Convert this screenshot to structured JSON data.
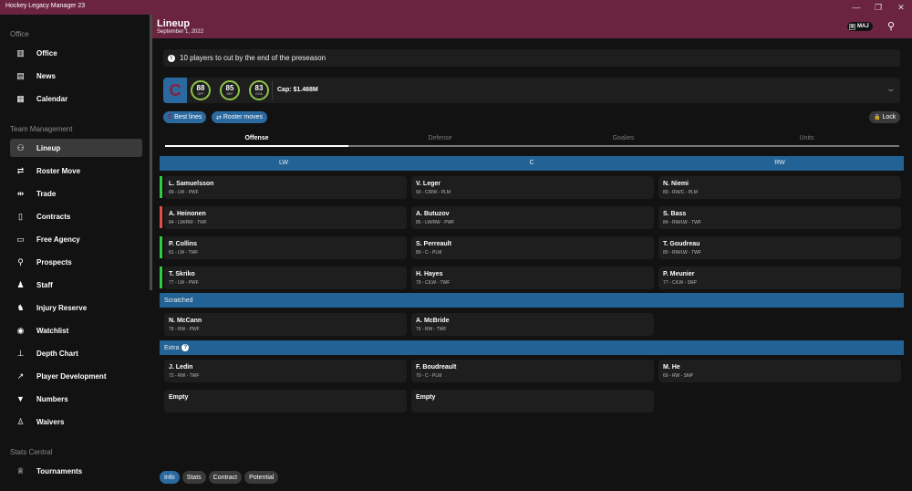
{
  "window": {
    "title": "Hockey Legacy Manager 23",
    "controls": [
      "—",
      "❐",
      "✕"
    ]
  },
  "sidebar": {
    "sections": [
      {
        "label": "Office",
        "items": [
          {
            "label": "Office",
            "icon": "building-icon",
            "glyph": "▥"
          },
          {
            "label": "News",
            "icon": "newspaper-icon",
            "glyph": "▤"
          },
          {
            "label": "Calendar",
            "icon": "calendar-icon",
            "glyph": "▦"
          }
        ]
      },
      {
        "label": "Team Management",
        "items": [
          {
            "label": "Lineup",
            "icon": "users-icon",
            "glyph": "👥",
            "active": true
          },
          {
            "label": "Roster Move",
            "icon": "exchange-icon",
            "glyph": "⇄"
          },
          {
            "label": "Trade",
            "icon": "trade-icon",
            "glyph": "⇹"
          },
          {
            "label": "Contracts",
            "icon": "contract-icon",
            "glyph": "▯"
          },
          {
            "label": "Free Agency",
            "icon": "money-icon",
            "glyph": "▭"
          },
          {
            "label": "Prospects",
            "icon": "binoculars-icon",
            "glyph": "⚲"
          },
          {
            "label": "Staff",
            "icon": "staff-icon",
            "glyph": "♟"
          },
          {
            "label": "Injury Reserve",
            "icon": "injury-icon",
            "glyph": "♞"
          },
          {
            "label": "Watchlist",
            "icon": "eye-icon",
            "glyph": "◉"
          },
          {
            "label": "Depth Chart",
            "icon": "sitemap-icon",
            "glyph": "⊥"
          },
          {
            "label": "Player Development",
            "icon": "chart-line-icon",
            "glyph": "↗"
          },
          {
            "label": "Numbers",
            "icon": "jersey-icon",
            "glyph": "▼"
          },
          {
            "label": "Waivers",
            "icon": "user-cog-icon",
            "glyph": "♙"
          }
        ]
      },
      {
        "label": "Stats Central",
        "items": [
          {
            "label": "Tournaments",
            "icon": "trophy-icon",
            "glyph": "🏆"
          }
        ]
      }
    ]
  },
  "header": {
    "title": "Lineup",
    "date": "September 1, 2022",
    "badge": "MAJ",
    "search_icon": "🔍"
  },
  "notice": {
    "text": "10 players to cut by the end of the preseason"
  },
  "team": {
    "logo_letter": "C",
    "ratings": [
      {
        "value": "88",
        "label": "OFF"
      },
      {
        "value": "85",
        "label": "DEF"
      },
      {
        "value": "83",
        "label": "GOA"
      }
    ],
    "cap": "Cap: $1.468M",
    "expand_icon": "⌄"
  },
  "actions": {
    "best_lines": "Best lines",
    "roster_moves": "Roster moves",
    "lock": "Lock"
  },
  "tabs": [
    {
      "label": "Offense",
      "active": true
    },
    {
      "label": "Defense"
    },
    {
      "label": "Goalies"
    },
    {
      "label": "Units"
    }
  ],
  "positions": [
    "LW",
    "C",
    "RW"
  ],
  "lines": [
    {
      "status_color": "#2ecc40",
      "players": [
        {
          "name": "L. Samuelsson",
          "detail": "89 - LW - PWF"
        },
        {
          "name": "V. Leger",
          "detail": "93 - C/RW - PLM"
        },
        {
          "name": "N. Niemi",
          "detail": "89 - RW/C - PLM"
        }
      ]
    },
    {
      "status_color": "#e74c4c",
      "players": [
        {
          "name": "A. Heinonen",
          "detail": "84 - LW/RW - TWF"
        },
        {
          "name": "A. Butuzov",
          "detail": "85 - LW/RW - PWF"
        },
        {
          "name": "S. Bass",
          "detail": "84 - RW/LW - TWF"
        }
      ]
    },
    {
      "status_color": "#2ecc40",
      "players": [
        {
          "name": "P. Collins",
          "detail": "81 - LW - TWF"
        },
        {
          "name": "S. Perreault",
          "detail": "80 - C - PLM"
        },
        {
          "name": "T. Goudreau",
          "detail": "80 - RW/LW - TWF"
        }
      ]
    },
    {
      "status_color": "#2ecc40",
      "players": [
        {
          "name": "T. Skriko",
          "detail": "77 - LW - PWF"
        },
        {
          "name": "H. Hayes",
          "detail": "79 - C/LW - TWF"
        },
        {
          "name": "P. Meunier",
          "detail": "77 - C/LW - SNP"
        }
      ]
    }
  ],
  "scratched": {
    "label": "Scratched",
    "players": [
      {
        "name": "N. McCann",
        "detail": "76 - RW - PWF"
      },
      {
        "name": "A. McBride",
        "detail": "76 - RW - TWF"
      }
    ]
  },
  "extra": {
    "label": "Extra",
    "help_icon": "?",
    "players": [
      {
        "name": "J. Ledin",
        "detail": "72 - RW - TWF"
      },
      {
        "name": "F. Boudreault",
        "detail": "70 - C - PLM"
      },
      {
        "name": "M. He",
        "detail": "69 - RW - SNP"
      },
      {
        "name": "Empty",
        "detail": ""
      },
      {
        "name": "Empty",
        "detail": ""
      }
    ]
  },
  "bottom_tabs": [
    {
      "label": "Info",
      "active": true
    },
    {
      "label": "Stats"
    },
    {
      "label": "Contract"
    },
    {
      "label": "Potential"
    }
  ]
}
